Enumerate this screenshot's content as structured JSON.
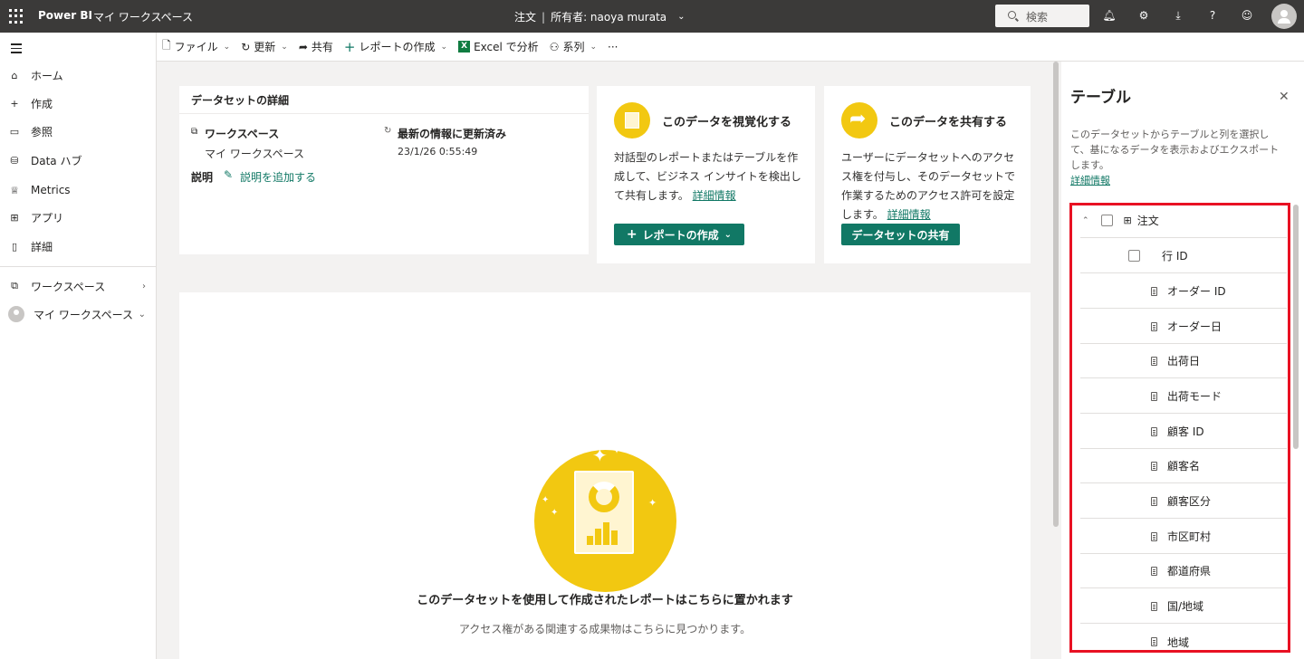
{
  "topbar": {
    "brand": "Power BI",
    "workspace": "マイ ワークスペース",
    "doc_title": "注文",
    "separator": "|",
    "owner": "所有者: naoya murata",
    "search_placeholder": "検索"
  },
  "sidebar": {
    "items": [
      {
        "label": "ホーム"
      },
      {
        "label": "作成"
      },
      {
        "label": "参照"
      },
      {
        "label": "Data ハブ"
      },
      {
        "label": "Metrics"
      },
      {
        "label": "アプリ"
      },
      {
        "label": "詳細"
      }
    ],
    "workspaces_label": "ワークスペース",
    "my_workspace_label": "マイ ワークスペース"
  },
  "toolbar": {
    "file": "ファイル",
    "refresh": "更新",
    "share": "共有",
    "create_report": "レポートの作成",
    "excel": "Excel で分析",
    "lineage": "系列",
    "more": "···"
  },
  "details": {
    "heading": "データセットの詳細",
    "workspace_label": "ワークスペース",
    "workspace_value": "マイ ワークスペース",
    "refreshed_label": "最新の情報に更新済み",
    "refreshed_value": "23/1/26 0:55:49",
    "description_label": "説明",
    "add_description": "説明を追加する"
  },
  "visualize": {
    "title": "このデータを視覚化する",
    "desc": "対話型のレポートまたはテーブルを作成して、ビジネス インサイトを検出して共有します。",
    "link": "詳細情報",
    "button": "レポートの作成"
  },
  "share": {
    "title": "このデータを共有する",
    "desc": "ユーザーにデータセットへのアクセス権を付与し、そのデータセットで作業するためのアクセス許可を設定します。",
    "link": "詳細情報",
    "button": "データセットの共有"
  },
  "empty": {
    "title": "このデータセットを使用して作成されたレポートはこちらに置かれます",
    "subtitle": "アクセス権がある関連する成果物はこちらに見つかります。"
  },
  "panel": {
    "title": "テーブル",
    "desc": "このデータセットからテーブルと列を選択して、基になるデータを表示およびエクスポートします。",
    "link": "詳細情報",
    "table_name": "注文",
    "columns": [
      "行 ID",
      "オーダー ID",
      "オーダー日",
      "出荷日",
      "出荷モード",
      "顧客 ID",
      "顧客名",
      "顧客区分",
      "市区町村",
      "都道府県",
      "国/地域",
      "地域"
    ]
  },
  "colors": {
    "accent": "#117865",
    "yellow": "#f2c811",
    "highlight": "#e81123",
    "topbar": "#3b3a39"
  }
}
